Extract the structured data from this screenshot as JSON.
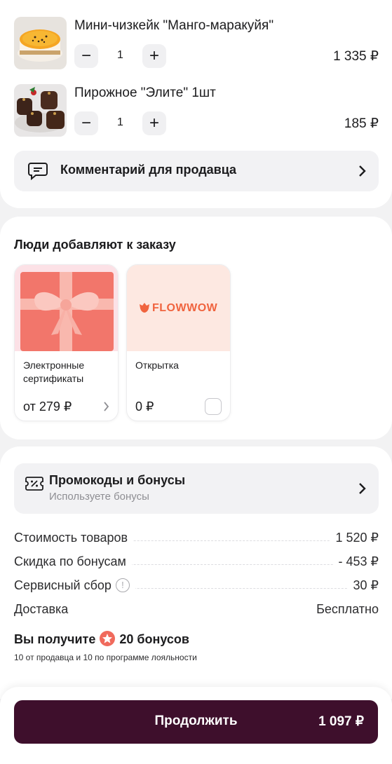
{
  "cart": {
    "items": [
      {
        "name": "Мини-чизкейк \"Манго-маракуйя\"",
        "qty": "1",
        "price": "1 335 ₽"
      },
      {
        "name": "Пирожное \"Элите\" 1шт",
        "qty": "1",
        "price": "185 ₽"
      }
    ],
    "minus_label": "−",
    "plus_label": "+",
    "comment_label": "Комментарий для продавца"
  },
  "addons": {
    "title": "Люди добавляют к заказу",
    "items": [
      {
        "title": "Электронные сертификаты",
        "price": "от 279 ₽"
      },
      {
        "title": "Открытка",
        "price": "0 ₽",
        "brand": "FLOWWOW"
      }
    ]
  },
  "promo": {
    "title": "Промокоды и бонусы",
    "subtitle": "Используете бонусы"
  },
  "summary": {
    "rows": [
      {
        "label": "Стоимость товаров",
        "value": "1 520 ₽"
      },
      {
        "label": "Скидка по бонусам",
        "value": "- 453 ₽"
      },
      {
        "label": "Сервисный сбор",
        "value": "30 ₽",
        "info": "!"
      },
      {
        "label": "Доставка",
        "value": "Бесплатно"
      }
    ],
    "bonus_prefix": "Вы получите",
    "bonus_amount": "20 бонусов",
    "bonus_note": "10 от продавца и 10 по программе лояльности"
  },
  "footer": {
    "continue_label": "Продолжить",
    "total": "1 097 ₽"
  },
  "colors": {
    "primary_button": "#3e0f2c",
    "bonus_star": "#f06a5c",
    "brand_flowwow": "#f0643f"
  }
}
